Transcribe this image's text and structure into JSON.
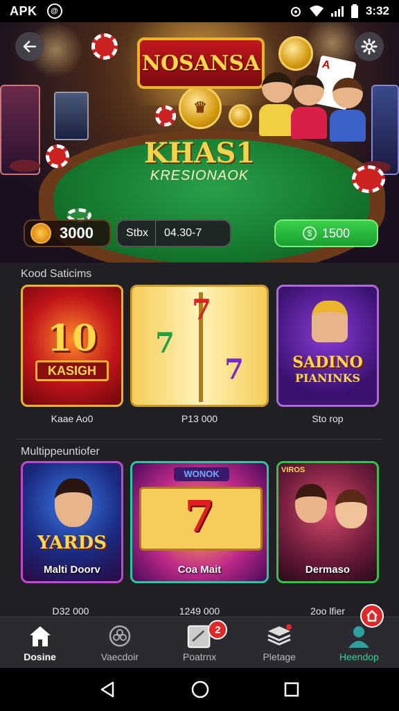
{
  "status_bar": {
    "carrier": "APK",
    "notif_badge": "@",
    "time": "3:32"
  },
  "hero": {
    "logo_text": "NOSANSA",
    "title": "KHAS1",
    "subtitle": "KRESIONAOK",
    "coins_value": "3000",
    "stats_label": "Stbx",
    "stats_value": "04.30-7",
    "cash_value": "1500",
    "card_text": "A"
  },
  "section1": {
    "title": "Kood Saticims",
    "cards": [
      {
        "big": "10",
        "banner": "KASIGH",
        "caption": "Kaae Ao0"
      },
      {
        "big": "7",
        "banner": "",
        "caption": "P13 000"
      },
      {
        "big": "SADINO",
        "banner": "PIANINKS",
        "caption": "Sto rop"
      }
    ]
  },
  "section2": {
    "title": "Multippeuntiofer",
    "cards": [
      {
        "big": "YARDS",
        "label": "Malti Doorv",
        "caption": "D32 000"
      },
      {
        "big": "7",
        "top": "WONOK",
        "label": "Coa Mait",
        "caption": "1249 000"
      },
      {
        "big": "VIROS",
        "label": "Dermaso",
        "caption": "2oo lfier"
      }
    ]
  },
  "bottom_nav": {
    "items": [
      "Dosine",
      "Vaecdoir",
      "Poatrnx",
      "Pletage",
      "Heendop"
    ],
    "badge": "2"
  },
  "colors": {
    "accent_green": "#1aa030",
    "gold": "#e8b52c",
    "badge_red": "#e02828",
    "teal": "#2fd39a"
  }
}
